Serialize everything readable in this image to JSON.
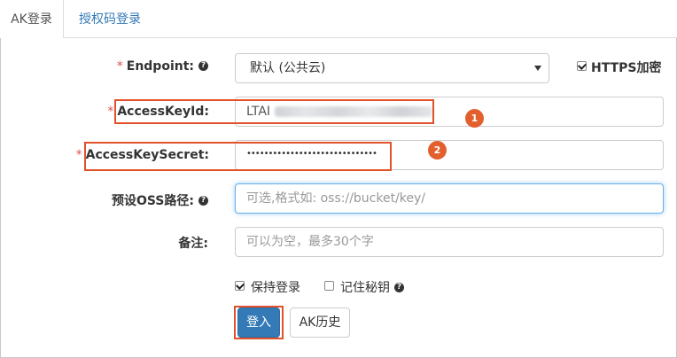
{
  "tabs": [
    {
      "label": "AK登录",
      "active": true
    },
    {
      "label": "授权码登录",
      "active": false
    }
  ],
  "form": {
    "endpoint": {
      "label": "Endpoint:",
      "value": "默认 (公共云)"
    },
    "https": {
      "label": "HTTPS加密",
      "checked": true
    },
    "access_key_id": {
      "label": "AccessKeyId:",
      "value": "LTAI"
    },
    "access_key_secret": {
      "label": "AccessKeySecret:",
      "value": "••••••••••••••••••••••••••••••"
    },
    "oss_path": {
      "label": "预设OSS路径:",
      "placeholder": "可选,格式如: oss://bucket/key/"
    },
    "note": {
      "label": "备注:",
      "placeholder": "可以为空，最多30个字"
    },
    "keep_login": {
      "label": "保持登录",
      "checked": true
    },
    "remember_secret": {
      "label": "记住秘钥",
      "checked": false
    },
    "required_mark": "*"
  },
  "buttons": {
    "login": "登入",
    "ak_history": "AK历史"
  },
  "annotations": [
    "1",
    "2"
  ],
  "colors": {
    "primary": "#337ab7",
    "annotation": "#e2522a",
    "required": "#d9534f"
  }
}
